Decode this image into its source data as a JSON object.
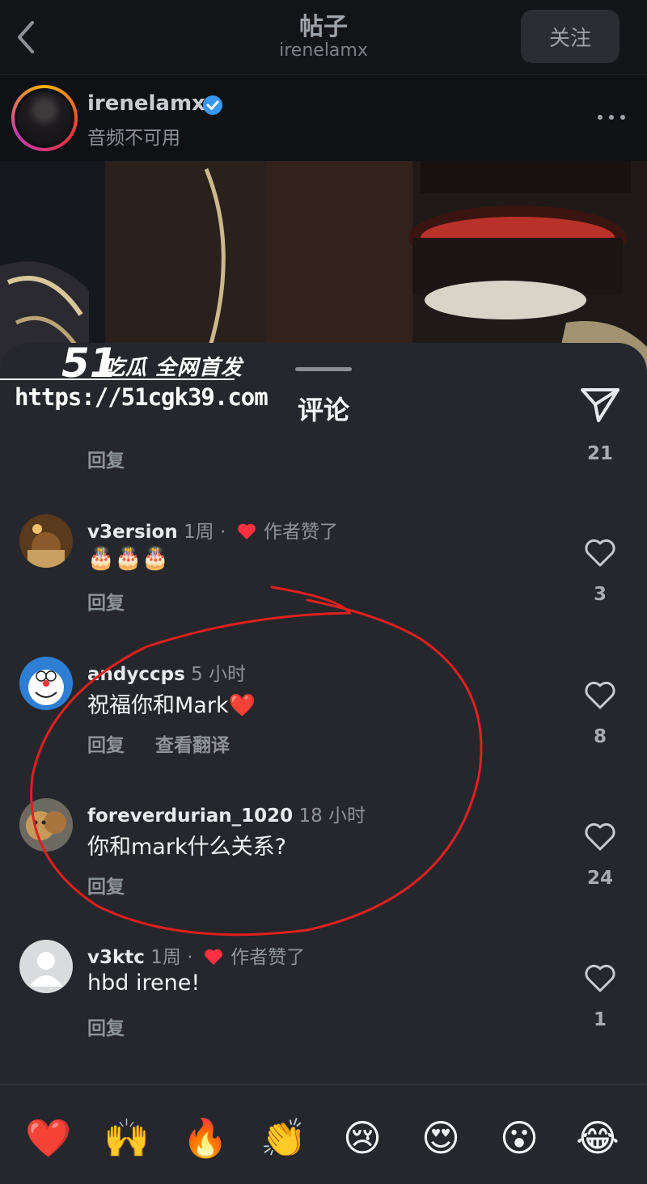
{
  "topbar": {
    "title": "帖子",
    "subtitle": "irenelamx",
    "follow_label": "关注"
  },
  "post": {
    "username": "irenelamx",
    "audio_note": "音频不可用"
  },
  "sheet": {
    "title": "评论"
  },
  "watermark": {
    "brand": "吃瓜 全网首发",
    "url": "https://51cgk39.com"
  },
  "first_row": {
    "reply_label": "回复",
    "like_count": "21"
  },
  "comments": [
    {
      "username": "v3ersion",
      "time": "1周",
      "separator": "·",
      "author_liked": "作者赞了",
      "text": "🎂🎂🎂",
      "reply_label": "回复",
      "translate_label": "",
      "like_count": "3"
    },
    {
      "username": "andyccps",
      "time": "5 小时",
      "separator": "",
      "author_liked": "",
      "text": "祝福你和Mark❤️",
      "reply_label": "回复",
      "translate_label": "查看翻译",
      "like_count": "8"
    },
    {
      "username": "foreverdurian_1020",
      "time": "18 小时",
      "separator": "",
      "author_liked": "",
      "text": "你和mark什么关系?",
      "reply_label": "回复",
      "translate_label": "",
      "like_count": "24"
    },
    {
      "username": "v3ktc",
      "time": "1周",
      "separator": "·",
      "author_liked": "作者赞了",
      "text": "hbd irene!",
      "reply_label": "回复",
      "translate_label": "",
      "like_count": "1"
    }
  ],
  "emoji_bar": [
    "❤️",
    "🙌",
    "🔥",
    "👏",
    "😢",
    "😍",
    "😮",
    "😂"
  ],
  "colors": {
    "accent_heart": "#ff3040",
    "annotation": "#e02020",
    "verified": "#3897f0"
  }
}
